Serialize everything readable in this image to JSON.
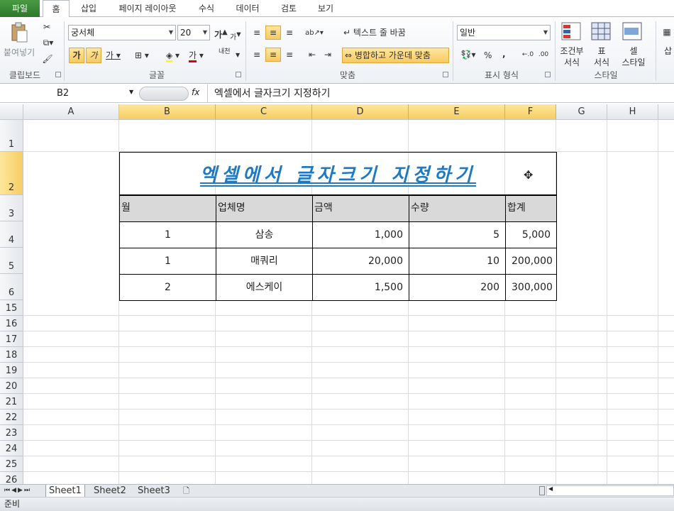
{
  "ribbon_tabs": [
    "파일",
    "홈",
    "삽입",
    "페이지 레이아웃",
    "수식",
    "데이터",
    "검토",
    "보기"
  ],
  "clipboard": {
    "paste_label": "붙여넣기",
    "group": "클립보드"
  },
  "font": {
    "name": "궁서체",
    "size": "20",
    "bold": "가",
    "italic": "가",
    "underline": "가",
    "group": "글꼴",
    "grow": "가",
    "shrink": "가",
    "color_label": "가",
    "phonetic": "내천"
  },
  "alignment": {
    "wrap": "텍스트 줄 바꿈",
    "merge": "병합하고 가운데 맞춤",
    "group": "맞춤"
  },
  "number": {
    "format": "일반",
    "percent": "%",
    "comma": ",",
    "group": "표시 형식"
  },
  "styles": {
    "conditional": "조건부\n서식",
    "table": "표\n서식",
    "cell": "셀\n스타일",
    "group": "스타일",
    "insert": "삽"
  },
  "formula_bar": {
    "name_box": "B2",
    "fx": "fx",
    "content": "엑셀에서 글자크기 지정하기"
  },
  "columns": [
    "A",
    "B",
    "C",
    "D",
    "E",
    "F",
    "G",
    "H"
  ],
  "rows": [
    "1",
    "2",
    "3",
    "4",
    "5",
    "6",
    "15",
    "16",
    "17",
    "18",
    "19",
    "20",
    "21",
    "22",
    "23",
    "24",
    "25",
    "26"
  ],
  "sheet": {
    "title": "엑셀에서 글자크기 지정하기",
    "headers": [
      "월",
      "업체명",
      "금액",
      "수량",
      "합계"
    ],
    "data": [
      [
        "1",
        "삼송",
        "1,000",
        "5",
        "5,000"
      ],
      [
        "1",
        "매쿼리",
        "20,000",
        "10",
        "200,000"
      ],
      [
        "2",
        "에스케이",
        "1,500",
        "200",
        "300,000"
      ]
    ]
  },
  "sheet_tabs": [
    "Sheet1",
    "Sheet2",
    "Sheet3"
  ],
  "status": "준비"
}
